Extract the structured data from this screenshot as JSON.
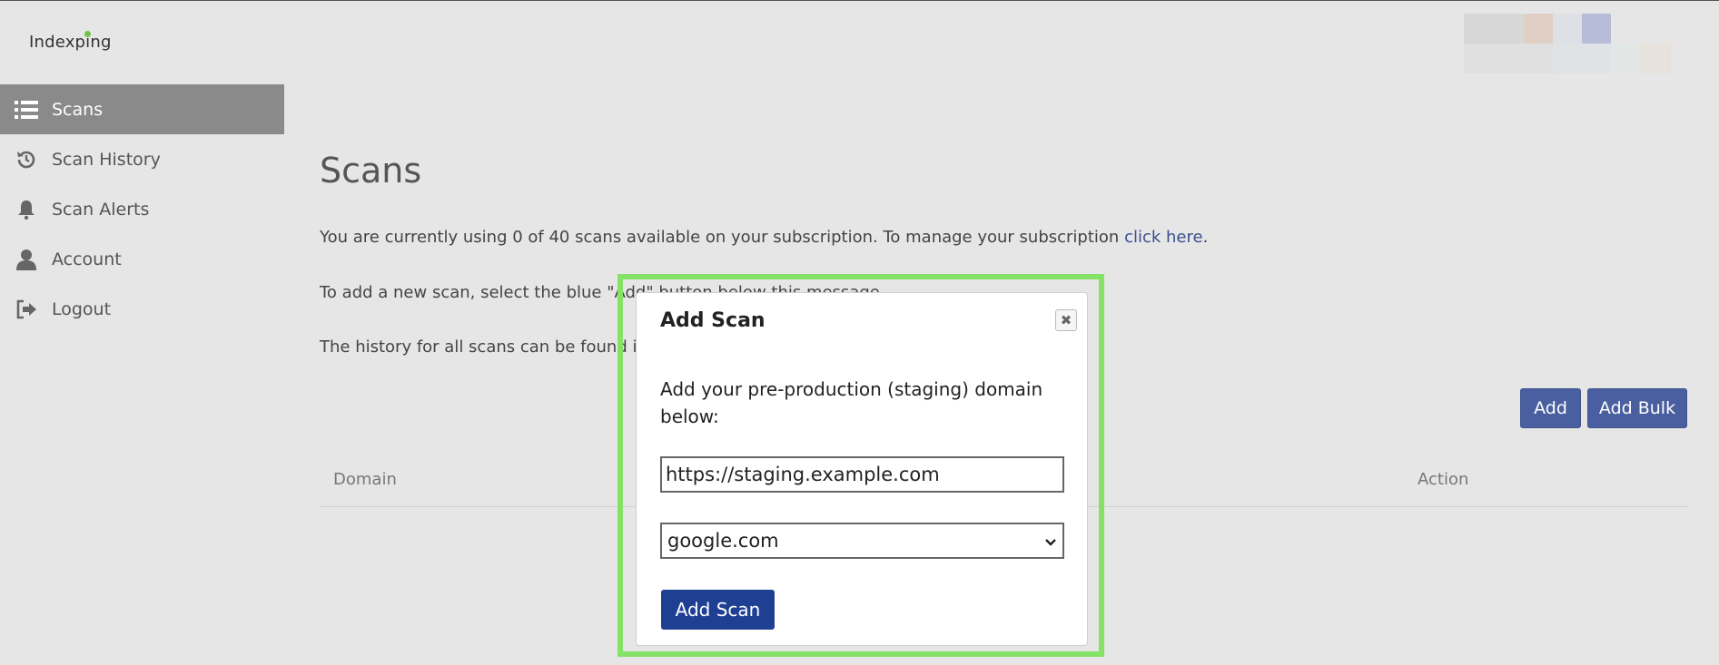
{
  "header": {
    "logo_text": "Indexping"
  },
  "sidebar": {
    "items": [
      {
        "label": "Scans",
        "icon": "list-icon",
        "active": true
      },
      {
        "label": "Scan History",
        "icon": "history-icon",
        "active": false
      },
      {
        "label": "Scan Alerts",
        "icon": "bell-icon",
        "active": false
      },
      {
        "label": "Account",
        "icon": "user-icon",
        "active": false
      },
      {
        "label": "Logout",
        "icon": "logout-icon",
        "active": false
      }
    ]
  },
  "main": {
    "title": "Scans",
    "usage_text": "You are currently using 0 of 40 scans available on your subscription. To manage your subscription ",
    "usage_link": "click here",
    "usage_end": ".",
    "add_instructions": "To add a new scan, select the blue \"Add\" button below this message.",
    "history_text": "The history for all scans can be found in",
    "add_button": "Add",
    "add_bulk_button": "Add Bulk",
    "table": {
      "columns": [
        "Domain",
        "Action"
      ]
    }
  },
  "modal": {
    "title": "Add Scan",
    "close_glyph": "✖",
    "description": "Add your pre-production (staging) domain below:",
    "domain_value": "https://staging.example.com",
    "search_engine_selected": "google.com",
    "submit_label": "Add Scan"
  },
  "colors": {
    "accent": "#4a5f9f",
    "modal_button": "#1f3f93",
    "highlight": "#84e266",
    "sidebar_active": "#8a8a8a"
  }
}
